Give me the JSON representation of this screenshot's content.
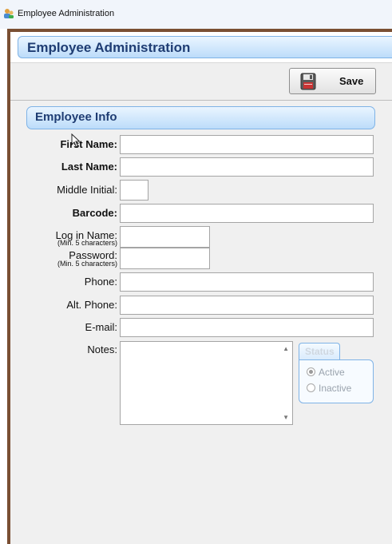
{
  "window": {
    "title": "Employee Administration"
  },
  "header": {
    "title": "Employee Administration"
  },
  "toolbar": {
    "save_label": "Save"
  },
  "section": {
    "title": "Employee Info"
  },
  "fields": {
    "first_name": {
      "label": "First Name:",
      "value": ""
    },
    "last_name": {
      "label": "Last Name:",
      "value": ""
    },
    "middle_initial": {
      "label": "Middle Initial:",
      "value": ""
    },
    "barcode": {
      "label": "Barcode:",
      "value": ""
    },
    "login_name": {
      "label": "Log in Name:",
      "hint": "(Min. 5 characters)",
      "value": ""
    },
    "password": {
      "label": "Password:",
      "hint": "(Min. 5 characters)",
      "value": ""
    },
    "phone": {
      "label": "Phone:",
      "value": ""
    },
    "alt_phone": {
      "label": "Alt. Phone:",
      "value": ""
    },
    "email": {
      "label": "E-mail:",
      "value": ""
    },
    "notes": {
      "label": "Notes:",
      "value": ""
    }
  },
  "status": {
    "label": "Status",
    "options": [
      {
        "label": "Active",
        "selected": true
      },
      {
        "label": "Inactive",
        "selected": false
      }
    ]
  },
  "colors": {
    "header_blue": "#1f3d73",
    "frame_brown": "#7a4f33",
    "accent_border": "#7fb3e6"
  }
}
